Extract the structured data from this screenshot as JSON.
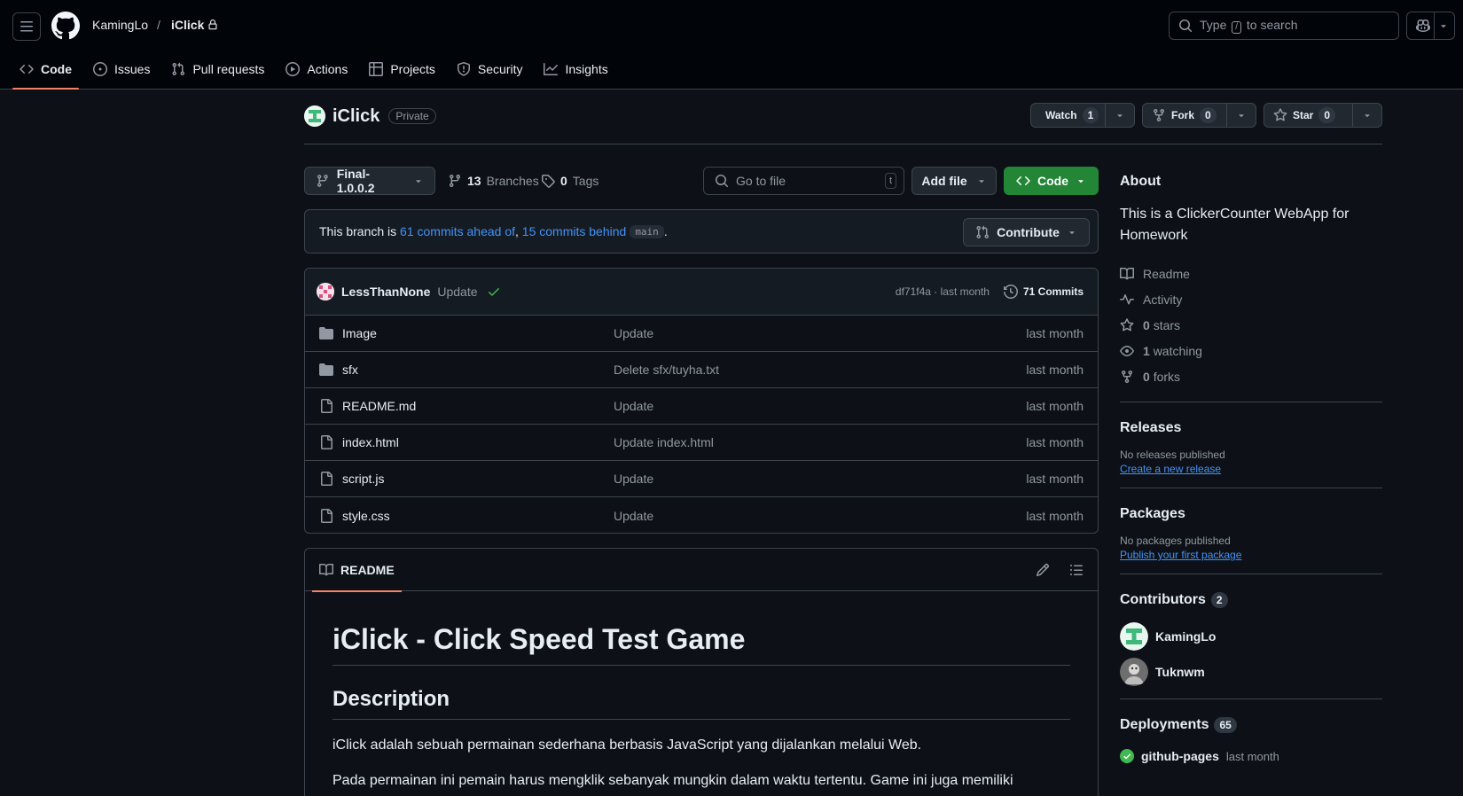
{
  "header": {
    "owner": "KamingLo",
    "separator": "/",
    "repo": "iClick",
    "search": {
      "before": "Type",
      "key": "/",
      "after": "to search"
    }
  },
  "nav": [
    {
      "label": "Code",
      "icon": "code-icon",
      "active": true
    },
    {
      "label": "Issues",
      "icon": "issue-icon"
    },
    {
      "label": "Pull requests",
      "icon": "pull-request-icon"
    },
    {
      "label": "Actions",
      "icon": "play-icon"
    },
    {
      "label": "Projects",
      "icon": "table-icon"
    },
    {
      "label": "Security",
      "icon": "shield-icon"
    },
    {
      "label": "Insights",
      "icon": "graph-icon"
    }
  ],
  "repo": {
    "name": "iClick",
    "visibility": "Private",
    "watch": {
      "label": "Watch",
      "count": "1"
    },
    "fork": {
      "label": "Fork",
      "count": "0"
    },
    "star": {
      "label": "Star",
      "count": "0"
    }
  },
  "toolbar": {
    "branch": "Final-1.0.0.2",
    "branches_count": "13",
    "branches_label": "Branches",
    "tags_count": "0",
    "tags_label": "Tags",
    "goto_placeholder": "Go to file",
    "goto_key": "t",
    "add_file": "Add file",
    "code": "Code"
  },
  "branch_info": {
    "prefix": "This branch is",
    "ahead": "61 commits ahead of",
    "comma": ",",
    "behind": "15 commits behind",
    "base": "main",
    "period": ".",
    "contribute": "Contribute"
  },
  "latest_commit": {
    "author": "LessThanNone",
    "message": "Update",
    "sha_time": "df71f4a · last month",
    "commits_label": "71 Commits"
  },
  "files": [
    {
      "name": "Image",
      "type": "folder",
      "message": "Update",
      "date": "last month"
    },
    {
      "name": "sfx",
      "type": "folder",
      "message": "Delete sfx/tuyha.txt",
      "date": "last month"
    },
    {
      "name": "README.md",
      "type": "file",
      "message": "Update",
      "date": "last month"
    },
    {
      "name": "index.html",
      "type": "file",
      "message": "Update index.html",
      "date": "last month"
    },
    {
      "name": "script.js",
      "type": "file",
      "message": "Update",
      "date": "last month"
    },
    {
      "name": "style.css",
      "type": "file",
      "message": "Update",
      "date": "last month"
    }
  ],
  "readme": {
    "tab": "README",
    "h1": "iClick - Click Speed Test Game",
    "h2": "Description",
    "p1": "iClick adalah sebuah permainan sederhana berbasis JavaScript yang dijalankan melalui Web.",
    "p2": "Pada permainan ini pemain harus mengklik sebanyak mungkin dalam waktu tertentu. Game ini juga memiliki"
  },
  "sidebar": {
    "about_title": "About",
    "description": "This is a ClickerCounter WebApp for Homework",
    "items": [
      {
        "icon": "book-icon",
        "count": "",
        "label": "Readme"
      },
      {
        "icon": "pulse-icon",
        "count": "",
        "label": "Activity"
      },
      {
        "icon": "star-icon",
        "count": "0",
        "label": "stars"
      },
      {
        "icon": "eye-icon",
        "count": "1",
        "label": "watching"
      },
      {
        "icon": "fork-icon",
        "count": "0",
        "label": "forks"
      }
    ],
    "releases_title": "Releases",
    "releases_none": "No releases published",
    "releases_link": "Create a new release",
    "packages_title": "Packages",
    "packages_none": "No packages published",
    "packages_link": "Publish your first package",
    "contributors_title": "Contributors",
    "contributors_count": "2",
    "contributors": [
      "KamingLo",
      "Tuknwm"
    ],
    "deployments_title": "Deployments",
    "deployments_count": "65",
    "deployment_name": "github-pages",
    "deployment_time": "last month"
  },
  "colors": {
    "background": "#0d1117",
    "header": "#010409",
    "border": "#3d444d",
    "link": "#4493f8",
    "primary_button": "#238636",
    "active_tab": "#f78166",
    "success": "#3fb950"
  }
}
